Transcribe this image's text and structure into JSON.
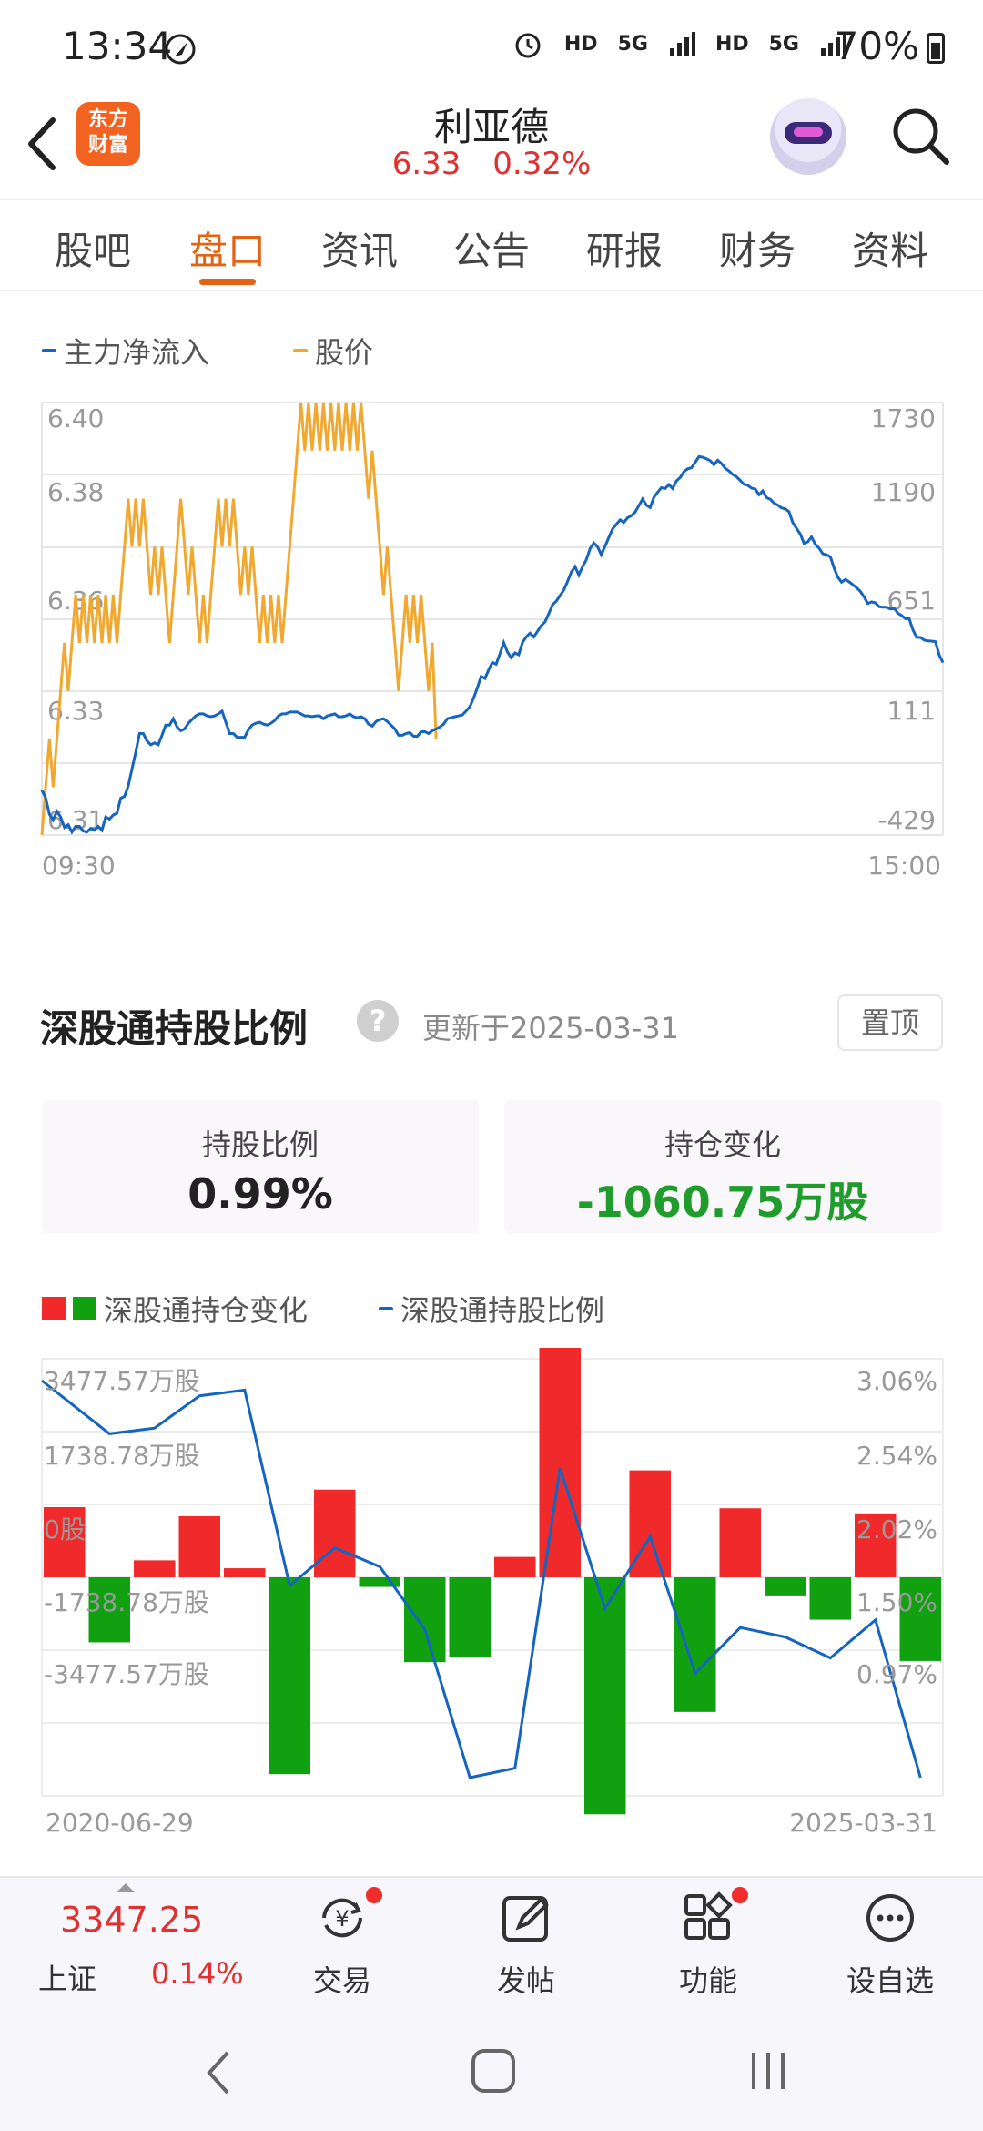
{
  "status_bar": {
    "time": "13:34",
    "network_icons": [
      "alarm-icon",
      "HD",
      "5G",
      "signal-icon",
      "HD",
      "5G",
      "signal-icon"
    ],
    "battery": "70%"
  },
  "header": {
    "logo_text": "东方财富",
    "title": "利亚德",
    "price": "6.33",
    "change_pct": "0.32%"
  },
  "tabs": [
    {
      "label": "股吧",
      "active": false
    },
    {
      "label": "盘口",
      "active": true
    },
    {
      "label": "资讯",
      "active": false
    },
    {
      "label": "公告",
      "active": false
    },
    {
      "label": "研报",
      "active": false
    },
    {
      "label": "财务",
      "active": false
    },
    {
      "label": "资料",
      "active": false
    }
  ],
  "flow_legend": {
    "main_inflow": "主力净流入",
    "price": "股价"
  },
  "colors": {
    "blue": "#1565c0",
    "orange": "#f0a830",
    "red": "#f02a2a",
    "green": "#10a010",
    "accent": "#e36313"
  },
  "holding_section": {
    "title": "深股通持股比例",
    "update_text": "更新于2025-03-31",
    "pin_label": "置顶",
    "ratio_label": "持股比例",
    "ratio_value": "0.99%",
    "change_label": "持仓变化",
    "change_value": "-1060.75万股"
  },
  "hold_legend": {
    "bars": "深股通持仓变化",
    "line": "深股通持股比例"
  },
  "chart_data": [
    {
      "type": "line",
      "series": [
        {
          "name": "主力净流入",
          "y_axis": "right",
          "values": [
            -205,
            -243,
            -325,
            -353,
            -311,
            -339,
            -391,
            -377,
            -414,
            -386,
            -386,
            -409,
            -414,
            -396,
            -405,
            -386,
            -405,
            -339,
            -349,
            -329,
            -320,
            -245,
            -236,
            -184,
            -100,
            -16,
            78,
            78,
            41,
            22,
            31,
            22,
            69,
            120,
            120,
            152,
            111,
            92,
            101,
            129,
            148,
            166,
            176,
            176,
            166,
            162,
            166,
            176,
            190,
            134,
            78,
            78,
            59,
            59,
            59,
            97,
            120,
            129,
            134,
            125,
            120,
            129,
            143,
            166,
            176,
            176,
            185,
            185,
            185,
            176,
            166,
            166,
            162,
            166,
            166,
            152,
            166,
            171,
            176,
            162,
            162,
            166,
            176,
            162,
            157,
            162,
            152,
            125,
            115,
            138,
            148,
            152,
            138,
            120,
            101,
            69,
            69,
            78,
            83,
            64,
            64,
            87,
            87,
            78,
            92,
            101,
            111,
            125,
            152,
            157,
            162,
            166,
            171,
            190,
            213,
            255,
            307,
            363,
            353,
            396,
            433,
            424,
            476,
            532,
            485,
            457,
            480,
            471,
            532,
            560,
            579,
            560,
            588,
            616,
            635,
            676,
            720,
            738,
            766,
            794,
            836,
            883,
            911,
            869,
            911,
            944,
            1001,
            1029,
            1010,
            971,
            1013,
            1057,
            1099,
            1122,
            1144,
            1132,
            1155,
            1165,
            1183,
            1215,
            1248,
            1218,
            1206,
            1257,
            1282,
            1305,
            1301,
            1320,
            1301,
            1338,
            1356,
            1385,
            1399,
            1404,
            1432,
            1460,
            1457,
            1449,
            1440,
            1419,
            1442,
            1426,
            1402,
            1388,
            1371,
            1360,
            1341,
            1322,
            1317,
            1303,
            1298,
            1270,
            1289,
            1256,
            1247,
            1228,
            1218,
            1204,
            1199,
            1185,
            1131,
            1102,
            1073,
            1027,
            1035,
            1059,
            1022,
            1003,
            975,
            970,
            960,
            903,
            858,
            833,
            847,
            835,
            821,
            806,
            787,
            759,
            727,
            735,
            730,
            711,
            708,
            708,
            699,
            703,
            678,
            667,
            651,
            651,
            595,
            558,
            558,
            544,
            540,
            539,
            536,
            470,
            432
          ]
        },
        {
          "name": "股价",
          "y_axis": "left",
          "values": [
            6.31,
            6.32,
            6.33,
            6.32,
            6.33,
            6.34,
            6.35,
            6.34,
            6.35,
            6.36,
            6.35,
            6.36,
            6.35,
            6.36,
            6.35,
            6.36,
            6.35,
            6.36,
            6.35,
            6.36,
            6.35,
            6.36,
            6.37,
            6.38,
            6.37,
            6.38,
            6.37,
            6.38,
            6.37,
            6.36,
            6.37,
            6.36,
            6.37,
            6.36,
            6.35,
            6.36,
            6.37,
            6.38,
            6.37,
            6.36,
            6.37,
            6.36,
            6.35,
            6.36,
            6.35,
            6.36,
            6.37,
            6.38,
            6.37,
            6.38,
            6.37,
            6.38,
            6.37,
            6.36,
            6.37,
            6.36,
            6.37,
            6.36,
            6.35,
            6.36,
            6.35,
            6.36,
            6.35,
            6.36,
            6.35,
            6.36,
            6.37,
            6.38,
            6.39,
            6.4,
            6.39,
            6.4,
            6.39,
            6.4,
            6.39,
            6.4,
            6.39,
            6.4,
            6.39,
            6.4,
            6.39,
            6.4,
            6.39,
            6.4,
            6.39,
            6.4,
            6.39,
            6.38,
            6.39,
            6.38,
            6.37,
            6.36,
            6.37,
            6.36,
            6.35,
            6.34,
            6.35,
            6.36,
            6.35,
            6.36,
            6.35,
            6.36,
            6.35,
            6.34,
            6.35,
            6.33
          ]
        }
      ],
      "x_labels": [
        "09:30",
        "15:00"
      ],
      "y_left_ticks": [
        "6.40",
        "6.38",
        "6.36",
        "6.33",
        "6.31"
      ],
      "y_right_ticks": [
        "1730",
        "1190",
        "651",
        "111",
        "-429"
      ],
      "ylim_left": [
        6.31,
        6.4
      ],
      "ylim_right": [
        -429,
        1730
      ]
    },
    {
      "type": "bar",
      "series": [
        {
          "name": "深股通持仓变化",
          "unit": "万股",
          "values": [
            1240,
            -1150,
            300,
            1080,
            160,
            -3480,
            1550,
            -170,
            -1500,
            -1420,
            360,
            4950,
            -4190,
            1890,
            -2380,
            1220,
            -320,
            -750,
            1130,
            -1480
          ]
        },
        {
          "name": "深股通持股比例",
          "unit": "%",
          "values": [
            3.06,
            2.78,
            2.81,
            2.98,
            3.01,
            1.98,
            2.18,
            2.08,
            1.75,
            0.97,
            1.02,
            2.6,
            1.86,
            2.24,
            1.52,
            1.76,
            1.71,
            1.6,
            1.8,
            0.97
          ]
        }
      ],
      "x_labels": [
        "2020-06-29",
        "2025-03-31"
      ],
      "y_left_ticks": [
        "3477.57万股",
        "1738.78万股",
        "0股",
        "-1738.78万股",
        "-3477.57万股"
      ],
      "y_right_ticks": [
        "3.06%",
        "2.54%",
        "2.02%",
        "1.50%",
        "0.97%"
      ],
      "ylim_left": [
        -3477.57,
        3477.57
      ],
      "ylim_right": [
        0.97,
        3.06
      ]
    }
  ],
  "bottom_nav": {
    "index_value": "3347.25",
    "index_name": "上证",
    "index_pct": "0.14%",
    "items": [
      {
        "label": "交易",
        "icon": "yen-refresh-icon",
        "dot": true
      },
      {
        "label": "发帖",
        "icon": "edit-icon",
        "dot": false
      },
      {
        "label": "功能",
        "icon": "grid-icon",
        "dot": true
      },
      {
        "label": "设自选",
        "icon": "more-icon",
        "dot": false
      }
    ]
  }
}
